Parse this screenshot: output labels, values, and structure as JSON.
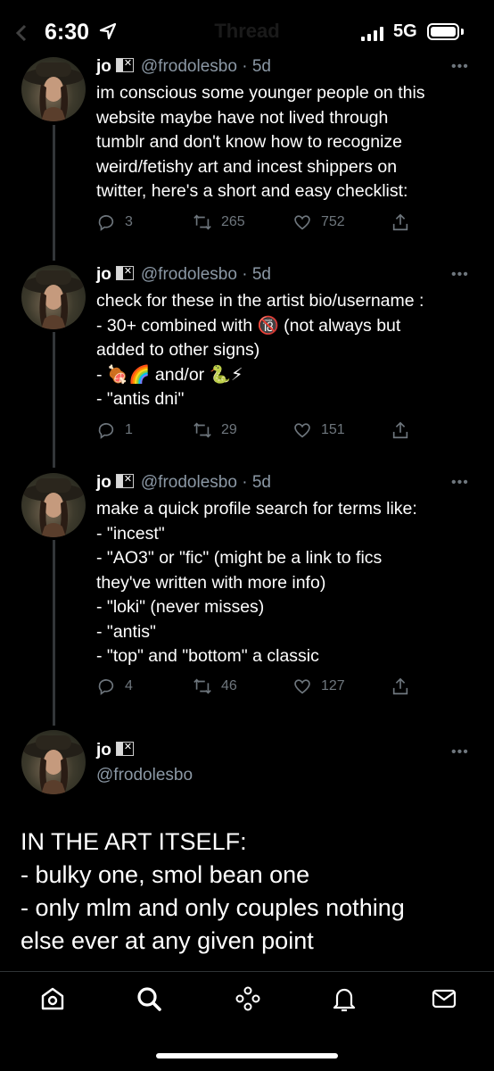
{
  "status_bar": {
    "time": "6:30",
    "network": "5G",
    "title": "Thread",
    "battery_level": 1.0
  },
  "tweets": [
    {
      "name": "jo",
      "handle": "@frodolesbo",
      "separator": "·",
      "time": "5d",
      "text": "im conscious some younger people on this\nwebsite maybe have not lived through\ntumblr and don't know how to recognize\nweird/fetishy art and incest shippers on\ntwitter, here's a short and easy checklist:",
      "replies": "3",
      "retweets": "265",
      "likes": "752"
    },
    {
      "name": "jo",
      "handle": "@frodolesbo",
      "separator": "·",
      "time": "5d",
      "text": "check for these in the artist bio/username :\n- 30+ combined with 🔞 (not always but\nadded to other signs)\n- 🍖🌈 and/or 🐍⚡\n- \"antis dni\"",
      "replies": "1",
      "retweets": "29",
      "likes": "151"
    },
    {
      "name": "jo",
      "handle": "@frodolesbo",
      "separator": "·",
      "time": "5d",
      "text": "make a quick profile search for terms like:\n- \"incest\"\n- \"AO3\" or \"fic\" (might be a link to fics\nthey've written with more info)\n- \"loki\" (never misses)\n- \"antis\"\n- \"top\" and \"bottom\" a classic",
      "replies": "4",
      "retweets": "46",
      "likes": "127"
    }
  ],
  "focused_tweet": {
    "name": "jo",
    "handle": "@frodolesbo",
    "text": "IN THE ART ITSELF:\n- bulky one, smol bean one\n- only mlm and only couples nothing\nelse ever at any given point"
  },
  "more_glyph": "•••",
  "tabbar": {
    "icons": [
      "home-icon",
      "search-icon",
      "spaces-icon",
      "notifications-icon",
      "messages-icon"
    ]
  }
}
